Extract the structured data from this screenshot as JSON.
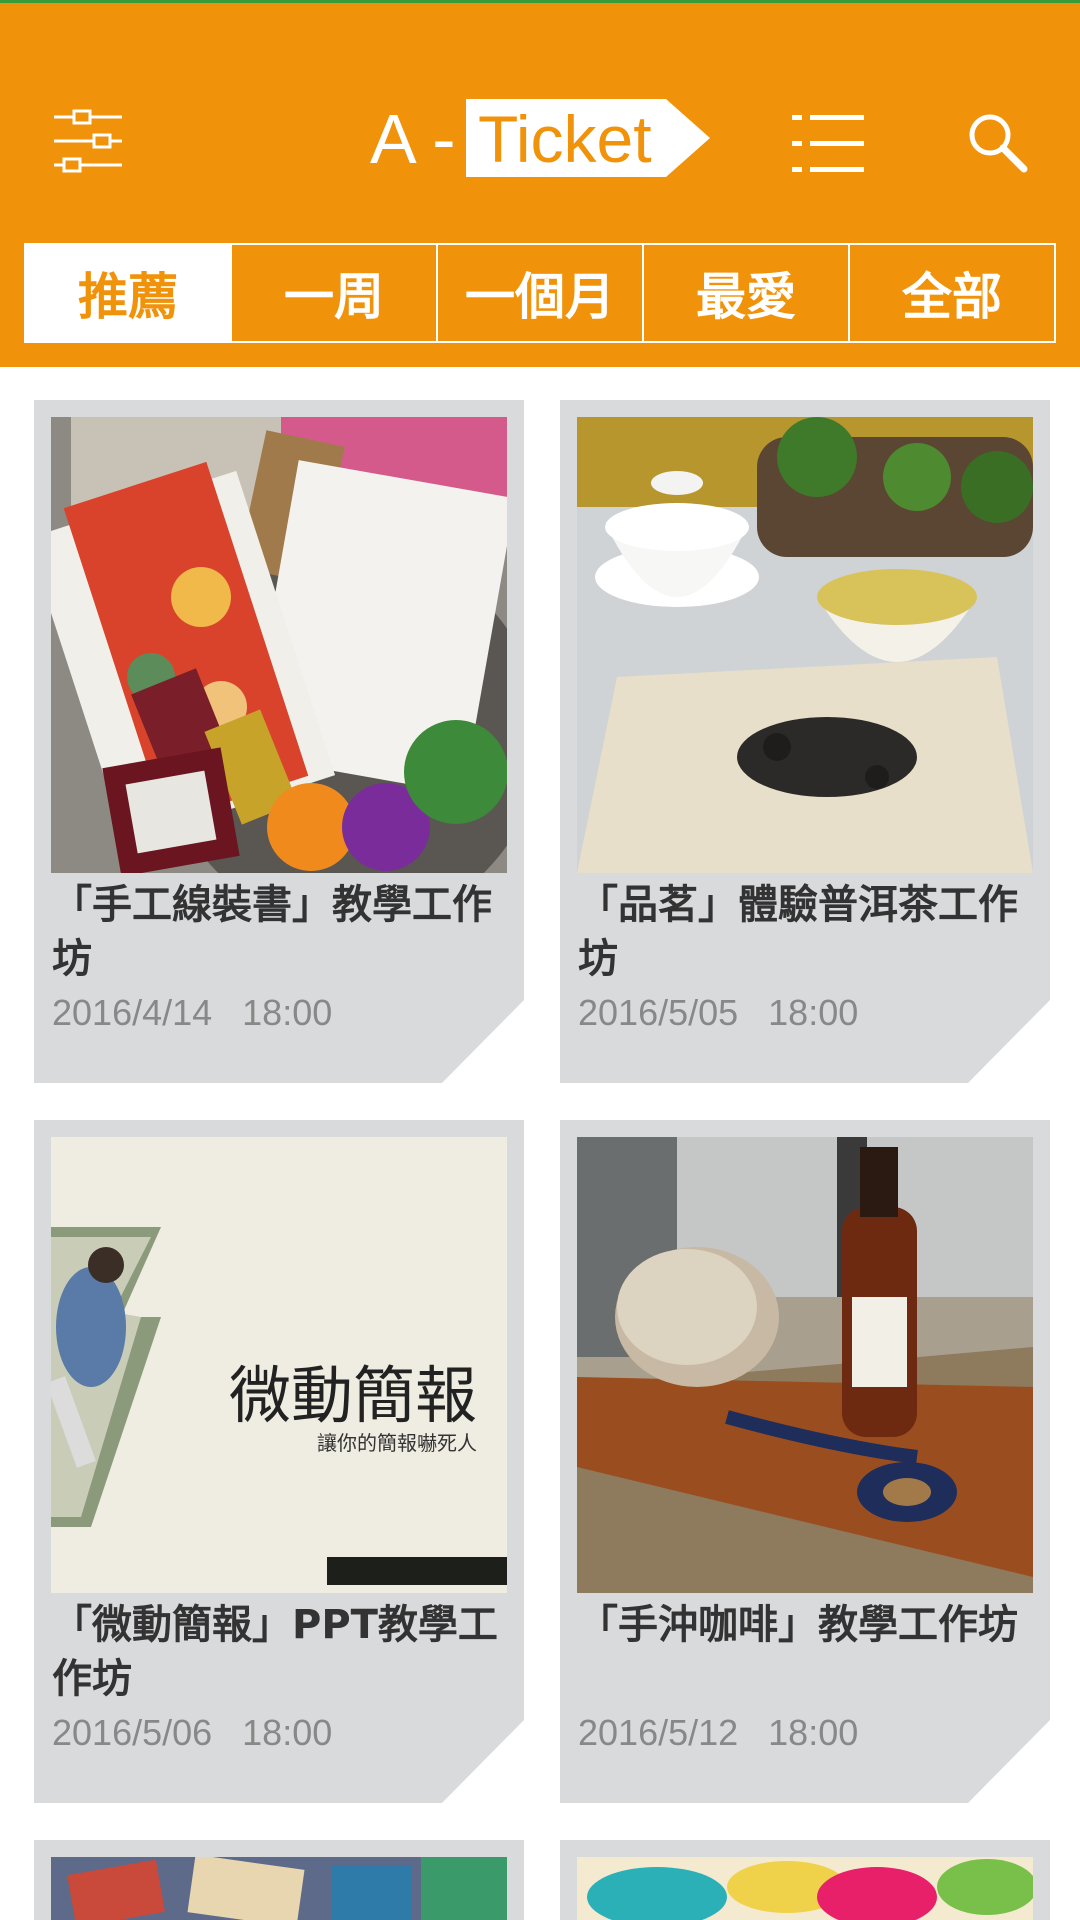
{
  "colors": {
    "brand": "#F0930A",
    "card_bg": "#D9DADC",
    "text": "#333333",
    "date": "#888888"
  },
  "header": {
    "logo_prefix": "A -",
    "logo_word": "Ticket",
    "icons": [
      "sliders-icon",
      "list-icon",
      "search-icon"
    ]
  },
  "tabs": [
    {
      "label": "推薦",
      "active": true
    },
    {
      "label": "一周",
      "active": false
    },
    {
      "label": "一個月",
      "active": false
    },
    {
      "label": "最愛",
      "active": false
    },
    {
      "label": "全部",
      "active": false
    }
  ],
  "events": [
    {
      "title": "「手工線裝書」教學工作坊",
      "date": "2016/4/14   18:00"
    },
    {
      "title": "「品茗」體驗普洱茶工作坊",
      "date": "2016/5/05   18:00"
    },
    {
      "title": "「微動簡報」PPT教學工作坊",
      "date": "2016/5/06   18:00",
      "poster_title": "微動簡報",
      "poster_subtitle": "讓你的簡報嚇死人"
    },
    {
      "title": "「手沖咖啡」教學工作坊",
      "date": "2016/5/12   18:00"
    }
  ]
}
